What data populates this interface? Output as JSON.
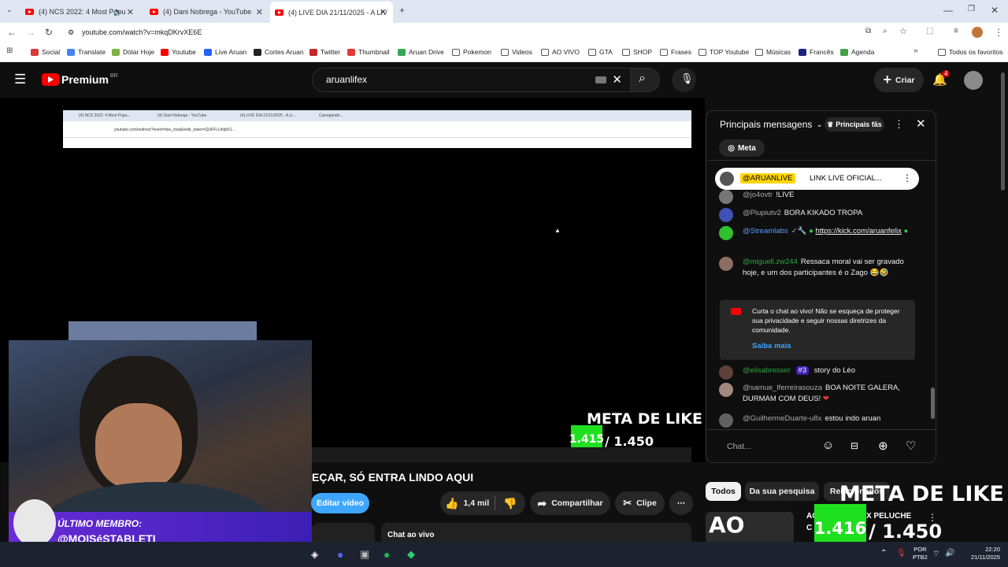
{
  "browser": {
    "tabs": [
      {
        "title": "(4) NCS 2022: 4 Most Popu"
      },
      {
        "title": "(4) Dani Nobrega - YouTube"
      },
      {
        "title": "(4) LIVE DIA 21/11/2025 - A LIV"
      }
    ],
    "url": "youtube.com/watch?v=mkqDKrvXE6E",
    "bookmarks": [
      "Social",
      "Translate",
      "Dólar Hoje",
      "Youtube",
      "Live Aruan",
      "Cortes Aruan",
      "Twitter",
      "Thumbnail",
      "Aruan Drive",
      "Pokemon",
      "Videos",
      "AO VIVO",
      "GTA",
      "SHOP",
      "Frases",
      "TOP Youtube",
      "Músicas",
      "Francês",
      "Agenda"
    ],
    "all_bookmarks": "Todos os favoritos"
  },
  "youtube": {
    "logo": "Premium",
    "logo_sup": "BR",
    "search_value": "aruanlifex",
    "create_label": "Criar",
    "notif_count": "4"
  },
  "video": {
    "title_fragment": "EÇAR, SÓ ENTRA LINDO AQUI",
    "meta_label": "META DE LIKE",
    "meta_current": "1.415",
    "meta_total": "/ 1.450",
    "inner_tabs": [
      "(4) NCS 2022: 4 Most Popu...",
      "(4) Dani Nobrega - YouTube",
      "(4) LIVE DIA 21/11/2025 - A Li...",
      "Carregando..."
    ],
    "inner_url": "youtube.com/redirect?event=live_chat&redir_token=QUFFLUhqb51...",
    "webcam_badge_title": "ÚLTIMO MEMBRO:",
    "webcam_badge_name": "@MOISéSTABLETI"
  },
  "actions": {
    "edit": "Editar vídeo",
    "likes": "1,4 mil",
    "share": "Compartilhar",
    "clip": "Clipe",
    "live_chat": "Chat ao vivo"
  },
  "chat": {
    "header": "Principais mensagens",
    "top_fans": "Principais fãs",
    "meta_btn": "Meta",
    "pinned_author": "@ARUANLIVE",
    "pinned_text": "LINK LIVE OFICIAL...",
    "messages": [
      {
        "author": "@jo4ovtr",
        "text": "!LIVE"
      },
      {
        "author": "@Piupiutv2",
        "text": "BORA KIKADO TROPA"
      },
      {
        "author": "@Streamlabs",
        "text": "https://kick.com/aruanfelix"
      },
      {
        "author": "@miguell.zw244",
        "text": "Ressaca moral vai ser gravado hoje, e um dos participantes é o Zago"
      },
      {
        "author": "@elisabresser",
        "badge": "#3",
        "text": "story do Léo"
      },
      {
        "author": "@samue_lferreirasouza",
        "text": "BOA NOITE GALERA, DURMAM COM DEUS!"
      },
      {
        "author": "@GuilhermeDuarte-u8x",
        "text": "estou indo aruan"
      }
    ],
    "notice": "Curta o chat ao vivo! Não se esqueça de proteger sua privacidade e seguir nossas diretrizes da comunidade.",
    "notice_link": "Saiba mais",
    "input_placeholder": "Chat..."
  },
  "filters": [
    "Todos",
    "Da sua pesquisa",
    "Relacionados"
  ],
  "overlay": {
    "meta_label": "META DE LIKE",
    "current": "1.416",
    "total": "/ 1.450",
    "rec_title_1": "AO",
    "rec_text_1": "X PELUCHE",
    "rec_title_2": "C"
  },
  "taskbar": {
    "lang": "POR",
    "lang2": "PTB2",
    "time": "22:20",
    "date": "21/11/2025"
  }
}
